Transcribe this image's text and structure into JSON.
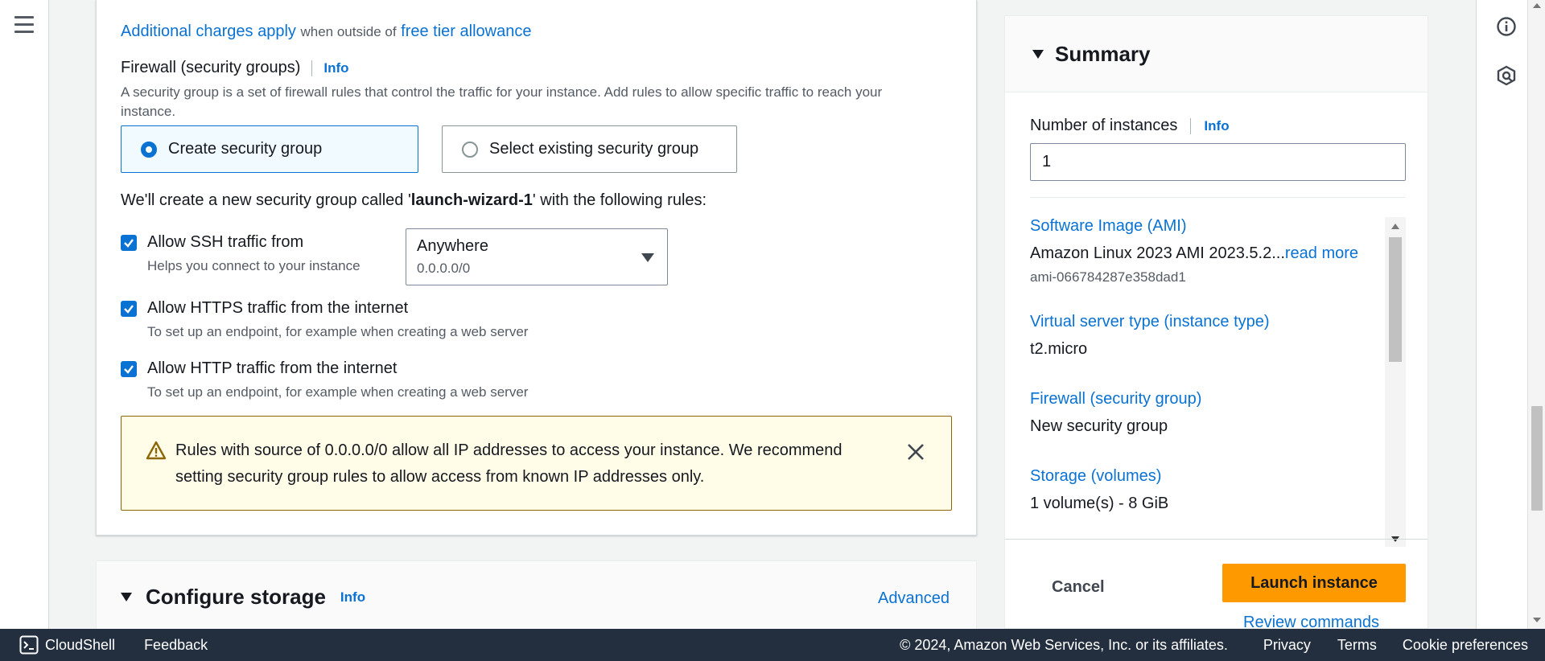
{
  "network": {
    "charges_link": "Additional charges apply",
    "charges_mid": "when outside of",
    "free_tier_link": "free tier allowance"
  },
  "firewall": {
    "label": "Firewall (security groups)",
    "info": "Info",
    "description": "A security group is a set of firewall rules that control the traffic for your instance. Add rules to allow specific traffic to reach your instance.",
    "option_create": "Create security group",
    "option_existing": "Select existing security group",
    "sg_prefix": "We'll create a new security group called '",
    "sg_name": "launch-wizard-1",
    "sg_suffix": "' with the following rules:",
    "rules": [
      {
        "label": "Allow SSH traffic from",
        "hint": "Helps you connect to your instance",
        "checked": true
      },
      {
        "label": "Allow HTTPS traffic from the internet",
        "hint": "To set up an endpoint, for example when creating a web server",
        "checked": true
      },
      {
        "label": "Allow HTTP traffic from the internet",
        "hint": "To set up an endpoint, for example when creating a web server",
        "checked": true
      }
    ],
    "ssh_source": {
      "value": "Anywhere",
      "sub": "0.0.0.0/0"
    },
    "warning": "Rules with source of 0.0.0.0/0 allow all IP addresses to access your instance. We recommend setting security group rules to allow access from known IP addresses only."
  },
  "storage": {
    "title": "Configure storage",
    "info": "Info",
    "advanced": "Advanced"
  },
  "summary": {
    "title": "Summary",
    "num_label": "Number of instances",
    "info": "Info",
    "num_value": "1",
    "ami_label": "Software Image (AMI)",
    "ami_value": "Amazon Linux 2023 AMI 2023.5.2...",
    "read_more": "read more",
    "ami_id": "ami-066784287e358dad1",
    "type_label": "Virtual server type (instance type)",
    "type_value": "t2.micro",
    "fw_label": "Firewall (security group)",
    "fw_value": "New security group",
    "storage_label": "Storage (volumes)",
    "storage_value": "1 volume(s) - 8 GiB",
    "cancel": "Cancel",
    "launch": "Launch instance",
    "review": "Review commands"
  },
  "footer": {
    "cloudshell": "CloudShell",
    "feedback": "Feedback",
    "copyright": "© 2024, Amazon Web Services, Inc. or its affiliates.",
    "privacy": "Privacy",
    "terms": "Terms",
    "cookies": "Cookie preferences"
  },
  "colors": {
    "accent": "#0972d3",
    "launch": "#ff9900",
    "footer_bg": "#232f3e",
    "warning_bg": "#fffce8"
  }
}
